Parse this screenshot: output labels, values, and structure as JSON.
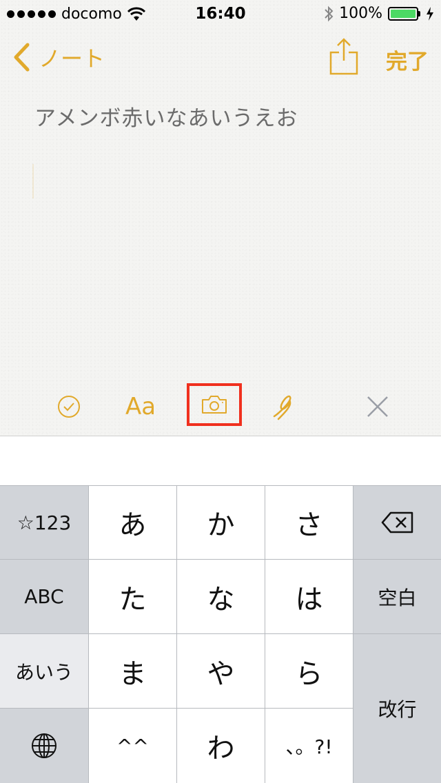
{
  "status_bar": {
    "carrier": "docomo",
    "time": "16:40",
    "battery_percent": "100%",
    "signal_dots": 5,
    "icons": [
      "wifi-icon",
      "bluetooth-icon",
      "battery-icon",
      "charging-icon"
    ]
  },
  "nav": {
    "back_label": "ノート",
    "done_label": "完了"
  },
  "note": {
    "text": "アメンボ赤いなあいうえお"
  },
  "toolbar": {
    "format_label": "Aa",
    "icons": [
      "checklist-icon",
      "format-icon",
      "camera-icon",
      "sketch-icon",
      "close-icon"
    ]
  },
  "keyboard": {
    "numbers_key": "☆123",
    "abc_key": "ABC",
    "kana_key": "あいう",
    "space_key": "空白",
    "return_key": "改行",
    "row1": [
      "あ",
      "か",
      "さ"
    ],
    "row2": [
      "た",
      "な",
      "は"
    ],
    "row3": [
      "ま",
      "や",
      "ら"
    ],
    "row4": [
      "^^",
      "わ",
      "、。?!"
    ]
  },
  "colors": {
    "accent": "#e1a92b",
    "highlight_box": "#f0301e",
    "battery": "#4cd964"
  }
}
